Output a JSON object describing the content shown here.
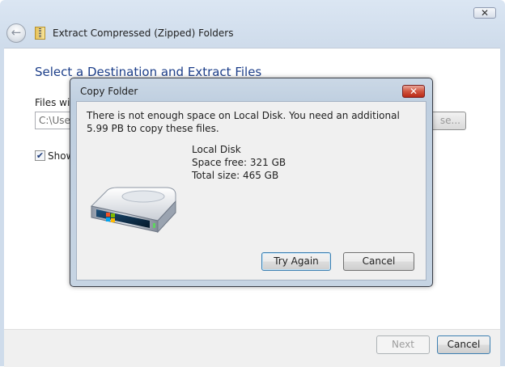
{
  "wizard": {
    "close_glyph": "✕",
    "title": "Extract Compressed (Zipped) Folders",
    "heading": "Select a Destination and Extract Files",
    "files_label": "Files will",
    "path_value": "C:\\User",
    "browse_label": "se...",
    "show_checked": true,
    "show_label": "Show",
    "next_label": "Next",
    "cancel_label": "Cancel"
  },
  "dialog": {
    "title": "Copy Folder",
    "close_glyph": "✕",
    "message": "There is not enough space on Local Disk. You need an additional 5.99 PB to copy these files.",
    "disk": {
      "name": "Local Disk",
      "space_free": "Space free: 321 GB",
      "total_size": "Total size: 465 GB"
    },
    "try_again_label": "Try Again",
    "cancel_label": "Cancel"
  },
  "icons": [
    "back-arrow-icon",
    "zip-folder-icon",
    "hard-drive-icon",
    "checkmark-icon"
  ],
  "colors": {
    "heading_blue": "#1d3f8a",
    "close_red": "#c8432e",
    "frame_blue": "#cbd8e6"
  }
}
